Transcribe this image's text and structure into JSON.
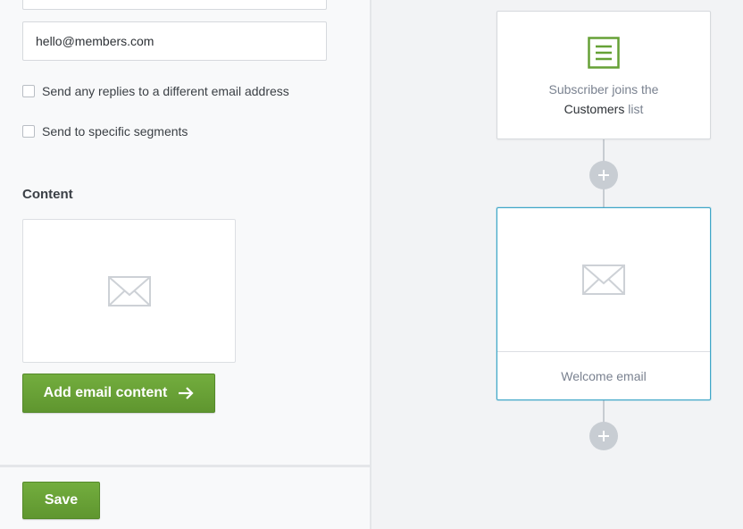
{
  "form": {
    "reply_to_value": "hello@members.com",
    "checkboxes": [
      {
        "label": "Send any replies to a different email address",
        "checked": false
      },
      {
        "label": "Send to specific segments",
        "checked": false
      }
    ],
    "content_title": "Content",
    "add_content_label": "Add email content",
    "save_label": "Save"
  },
  "workflow": {
    "trigger": {
      "text_before": "Subscriber joins the",
      "list_name": "Customers",
      "text_after": "list",
      "icon": "list-document-icon"
    },
    "email_step": {
      "label": "Welcome email",
      "icon": "envelope-icon"
    },
    "add_step_icon": "plus-icon"
  },
  "colors": {
    "primary_green": "#66a136",
    "selected_blue": "#3fa6c8",
    "connector_gray": "#c8cdd3"
  }
}
